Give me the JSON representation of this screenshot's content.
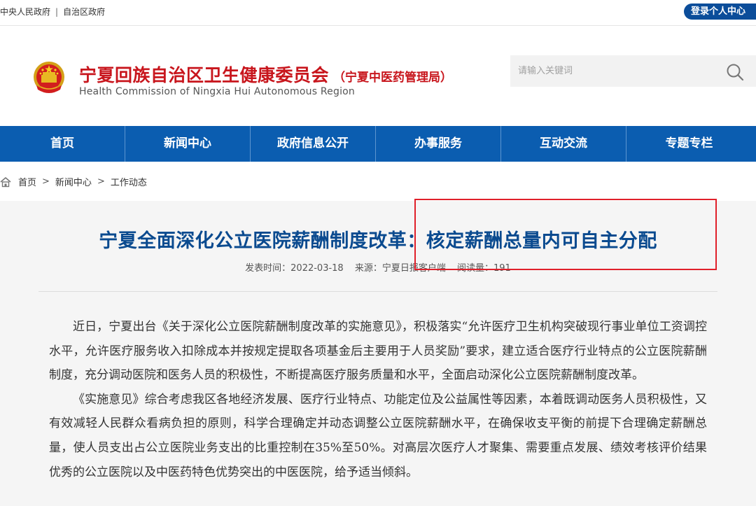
{
  "topbar": {
    "links": [
      "中央人民政府",
      "自治区政府"
    ],
    "separator": "|",
    "login_label": "登录个人中心"
  },
  "header": {
    "title_cn": "宁夏回族自治区卫生健康委员会",
    "title_sub": "（宁夏中医药管理局）",
    "title_en": "Health Commission of Ningxia Hui Autonomous Region",
    "search_placeholder": "请输入关键词"
  },
  "nav": {
    "items": [
      {
        "label": "首页"
      },
      {
        "label": "新闻中心"
      },
      {
        "label": "政府信息公开"
      },
      {
        "label": "办事服务"
      },
      {
        "label": "互动交流"
      },
      {
        "label": "专题专栏"
      }
    ]
  },
  "breadcrumb": {
    "items": [
      "首页",
      "新闻中心",
      "工作动态"
    ],
    "separator": ">"
  },
  "article": {
    "title": "宁夏全面深化公立医院薪酬制度改革：核定薪酬总量内可自主分配",
    "meta": {
      "date": "发表时间：2022-03-18",
      "source": "来源：宁夏日报客户端",
      "views": "阅读量：191"
    },
    "paragraphs": [
      "近日，宁夏出台《关于深化公立医院薪酬制度改革的实施意见》，积极落实“允许医疗卫生机构突破现行事业单位工资调控水平，允许医疗服务收入扣除成本并按规定提取各项基金后主要用于人员奖励”要求，建立适合医疗行业特点的公立医院薪酬制度，充分调动医院和医务人员的积极性，不断提高医疗服务质量和水平，全面启动深化公立医院薪酬制度改革。",
      "《实施意见》综合考虑我区各地经济发展、医疗行业特点、功能定位及公益属性等因素，本着既调动医务人员积极性，又有效减轻人民群众看病负担的原则，科学合理确定并动态调整公立医院薪酬水平，在确保收支平衡的前提下合理确定薪酬总量，使人员支出占公立医院业务支出的比重控制在35%至50%。对高层次医疗人才聚集、需要重点发展、绩效考核评价结果优秀的公立医院以及中医药特色优势突出的中医医院，给予适当倾斜。"
    ]
  },
  "colors": {
    "nav_bg": "#0b5db0",
    "title_red": "#c8161d",
    "article_title_blue": "#0a4a8f",
    "highlight_red": "#e0202a",
    "login_bg": "#0b4d9a"
  }
}
